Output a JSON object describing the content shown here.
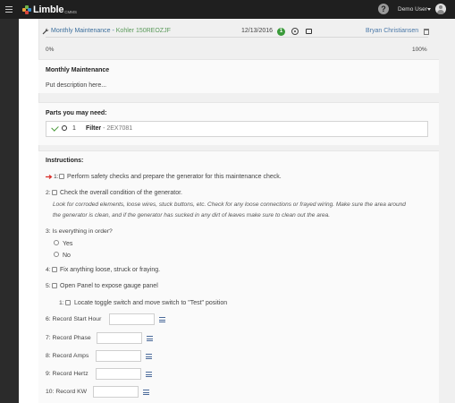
{
  "topbar": {
    "logo_text": "Limble",
    "logo_sub": "CMMS",
    "help_glyph": "?",
    "user_name": "Demo User",
    "icons": [
      "hamburger-icon",
      "help-icon",
      "chevron-down-icon",
      "avatar-icon"
    ]
  },
  "task": {
    "title_prefix": "Monthly Maintenance - ",
    "asset": "Kohler 150REOZJF",
    "date": "12/13/2016",
    "badge_count": "1",
    "assignee": "Bryan Christiansen",
    "progress_start": "0%",
    "progress_end": "100%",
    "progress_fraction": 0
  },
  "description": {
    "title": "Monthly Maintenance",
    "text": "Put description here..."
  },
  "parts": {
    "title": "Parts you may need:",
    "items": [
      {
        "qty": "1",
        "name": "Filter",
        "sep": " - ",
        "number": "2EX7081"
      }
    ]
  },
  "instructions": {
    "title": "Instructions:",
    "step1": "1:",
    "step1_text": "Perform safety checks and prepare the generator for this maintenance check.",
    "step2": "2:",
    "step2_text": "Check the overall condition of the generator.",
    "step2_note_1": "Look for corroded elements, loose wires, stuck buttons, etc.  Check for any loose connections or frayed wiring.  Make sure the area around",
    "step2_note_2": "the generator is clean, and if the generator has sucked in any dirt of leaves make sure to clean out the area.",
    "step3": "3: Is everything in order?",
    "opt_yes": "Yes",
    "opt_no": "No",
    "step4": "4:",
    "step4_text": "Fix anything loose, struck or fraying.",
    "step5": "5:",
    "step5_text": "Open Panel to expose gauge panel",
    "sub1": "1:",
    "sub1_text": "Locate toggle switch and move switch to \"Test\" position",
    "step6": "6: Record Start Hour",
    "step7": "7: Record Phase",
    "step8": "8: Record Amps",
    "step9": "9: Record Hertz",
    "step10": "10: Record KW"
  },
  "colors": {
    "link": "#3b6e9c",
    "asset": "#5a9a5a",
    "badge": "#3a9a3a",
    "arrow": "#d9302b",
    "check": "#4a9a3a"
  }
}
